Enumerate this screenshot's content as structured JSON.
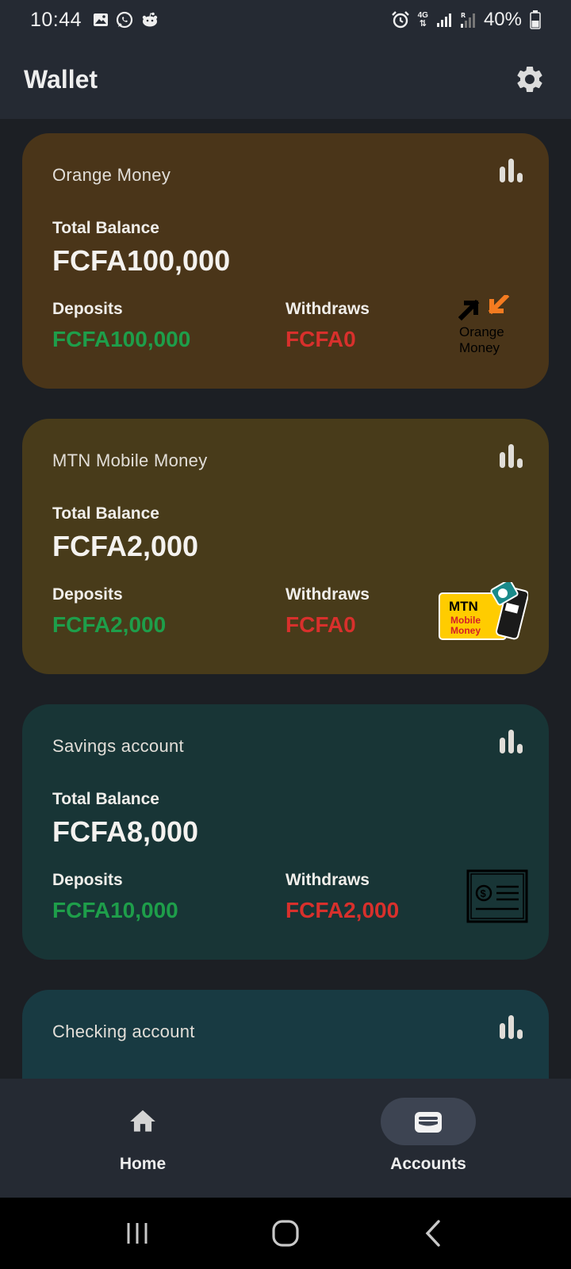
{
  "status_bar": {
    "time": "10:44",
    "battery": "40%",
    "network": "4G",
    "left_icons": [
      "gallery-icon",
      "whatsapp-icon",
      "reddit-icon"
    ],
    "right_icons": [
      "alarm-icon",
      "data-arrows-icon",
      "signal-icon",
      "roaming-signal-icon",
      "battery-icon"
    ]
  },
  "app_bar": {
    "title": "Wallet",
    "settings_icon": "gear-icon"
  },
  "accounts": [
    {
      "name": "Orange Money",
      "total_label": "Total Balance",
      "total": "FCFA100,000",
      "deposits_label": "Deposits",
      "deposits": "FCFA100,000",
      "withdraws_label": "Withdraws",
      "withdraws": "FCFA0",
      "logo_text": [
        "Orange",
        "Money"
      ],
      "color": "#4a3519"
    },
    {
      "name": "MTN Mobile Money",
      "total_label": "Total Balance",
      "total": "FCFA2,000",
      "deposits_label": "Deposits",
      "deposits": "FCFA2,000",
      "withdraws_label": "Withdraws",
      "withdraws": "FCFA0",
      "logo_text": [
        "MTN",
        "Mobile",
        "Money"
      ],
      "color": "#483b1a"
    },
    {
      "name": "Savings account",
      "total_label": "Total Balance",
      "total": "FCFA8,000",
      "deposits_label": "Deposits",
      "deposits": "FCFA10,000",
      "withdraws_label": "Withdraws",
      "withdraws": "FCFA2,000",
      "color": "#183536"
    },
    {
      "name": "Checking account",
      "color": "#183a42"
    }
  ],
  "bottom_nav": {
    "items": [
      {
        "label": "Home",
        "icon": "home-icon",
        "active": false
      },
      {
        "label": "Accounts",
        "icon": "wallet-icon",
        "active": true
      }
    ]
  },
  "colors": {
    "deposit": "#1e9e4a",
    "withdraw": "#d8302c",
    "bar": "#252a33",
    "background": "#1c1f24"
  }
}
